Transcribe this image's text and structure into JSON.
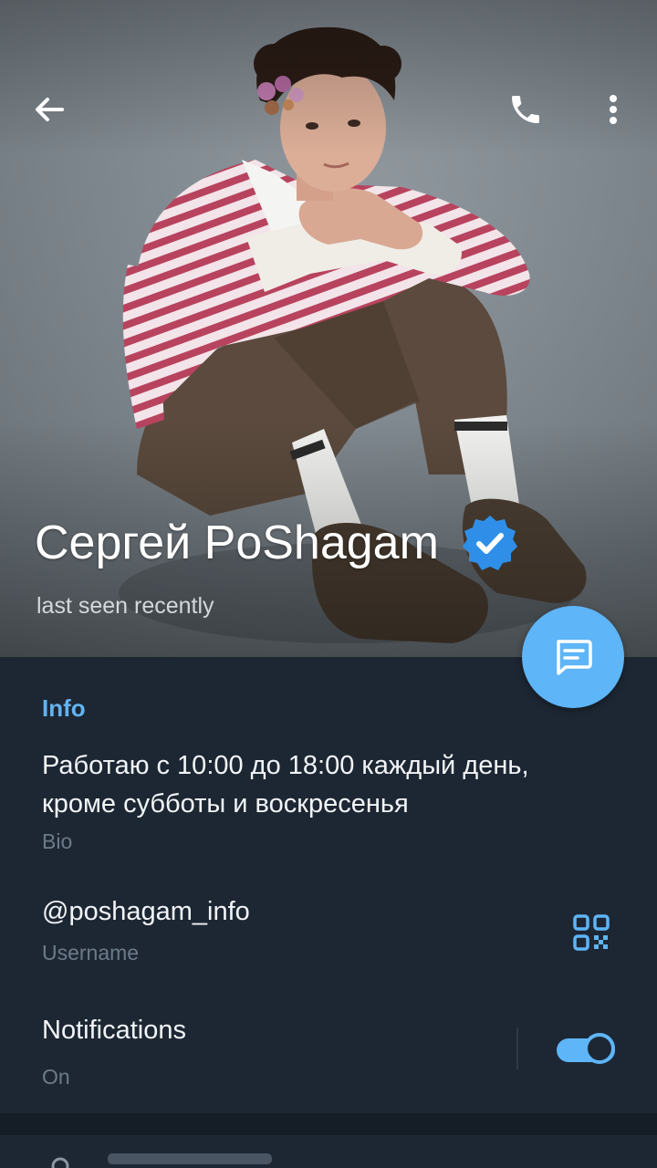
{
  "header": {
    "photo": "profile-photo",
    "back_icon": "arrow-left-icon",
    "call_icon": "phone-icon",
    "more_icon": "more-vertical-icon"
  },
  "profile": {
    "name": "Сергей PoShagam",
    "verified_icon": "verified-badge-icon",
    "status": "last seen recently"
  },
  "fab": {
    "icon": "message-icon"
  },
  "info": {
    "title": "Info",
    "bio": {
      "value": "Работаю с 10:00 до 18:00 каждый день, кроме субботы и воскресенья",
      "label": "Bio"
    },
    "username": {
      "value": "@poshagam_info",
      "label": "Username",
      "qr_icon": "qr-code-icon"
    },
    "notifications": {
      "value": "Notifications",
      "label": "On",
      "enabled": true
    }
  },
  "colors": {
    "accent": "#5eb5f7",
    "section_title": "#63b3f2",
    "background": "#1d2733",
    "secondary_text": "#6d7b89"
  }
}
